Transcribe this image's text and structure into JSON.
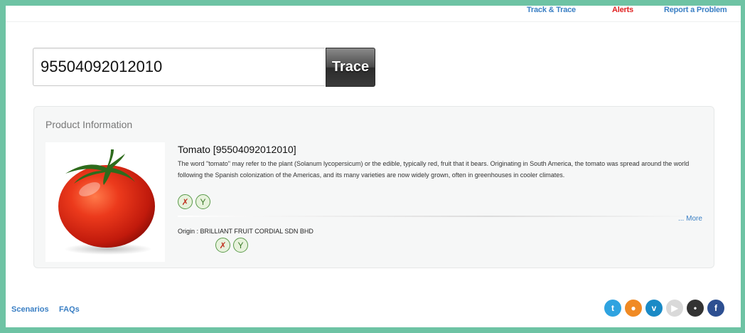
{
  "nav": {
    "track_trace": "Track & Trace",
    "alerts": "Alerts",
    "report": "Report a Problem"
  },
  "search": {
    "value": "95504092012010",
    "button_label": "Trace"
  },
  "panel": {
    "title": "Product Information",
    "product_name": "Tomato [95504092012010]",
    "description": "The word \"tomato\" may refer to the plant (Solanum lycopersicum) or the edible, typically red, fruit that it bears. Originating in South America, the tomato was spread around the world following the Spanish colonization of the Americas, and its many varieties are now widely grown, often in greenhouses in cooler climates.",
    "more_label": "... More",
    "origin": "Origin : BRILLIANT FRUIT CORDIAL SDN BHD",
    "badges": [
      "no-meat-icon",
      "no-alcohol-icon"
    ]
  },
  "footer": {
    "scenarios": "Scenarios",
    "faqs": "FAQs"
  },
  "social": [
    {
      "name": "twitter-icon",
      "glyph": "t",
      "color": "#2fa3e0"
    },
    {
      "name": "rss-icon",
      "glyph": "●",
      "color": "#f08a24"
    },
    {
      "name": "vimeo-icon",
      "glyph": "v",
      "color": "#1a8ac6"
    },
    {
      "name": "youtube-icon",
      "glyph": "▶",
      "color": "#d9d9d9"
    },
    {
      "name": "flickr-icon",
      "glyph": "•",
      "color": "#333333"
    },
    {
      "name": "facebook-icon",
      "glyph": "f",
      "color": "#2d4f91"
    }
  ]
}
